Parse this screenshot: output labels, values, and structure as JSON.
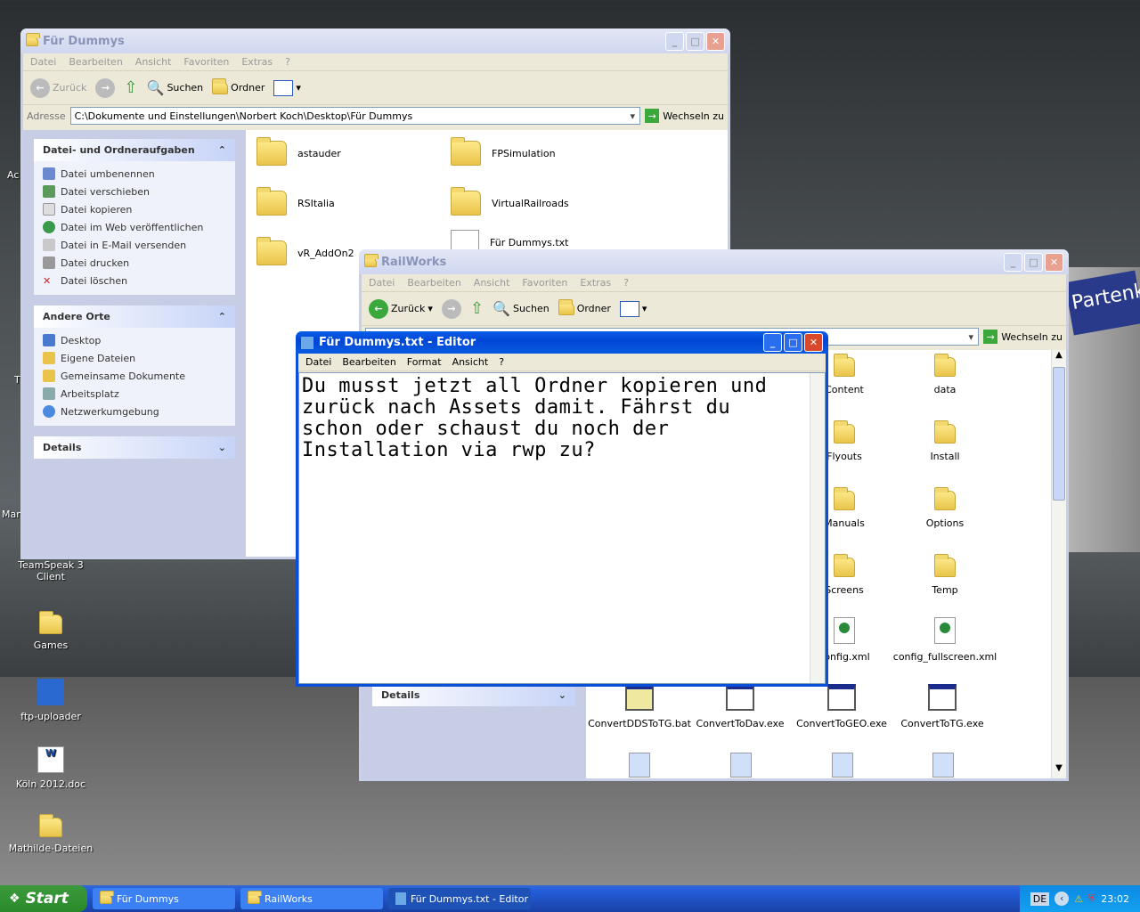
{
  "desktop": {
    "icons": [
      "TeamSpeak 3 Client",
      "Games",
      "ftp-uploader",
      "Köln 2012.doc",
      "Mathilde-Dateien"
    ],
    "partial_labels": [
      "Ac",
      "T",
      "Man"
    ],
    "bg_sign": "Partenkir"
  },
  "win1": {
    "title": "Für Dummys",
    "menu": [
      "Datei",
      "Bearbeiten",
      "Ansicht",
      "Favoriten",
      "Extras",
      "?"
    ],
    "toolbar": {
      "back": "Zurück",
      "search": "Suchen",
      "folders": "Ordner"
    },
    "address_label": "Adresse",
    "address": "C:\\Dokumente und Einstellungen\\Norbert Koch\\Desktop\\Für Dummys",
    "go": "Wechseln zu",
    "tasks_title": "Datei- und Ordneraufgaben",
    "tasks": [
      "Datei umbenennen",
      "Datei verschieben",
      "Datei kopieren",
      "Datei im Web veröffentlichen",
      "Datei in E-Mail versenden",
      "Datei drucken",
      "Datei löschen"
    ],
    "places_title": "Andere Orte",
    "places": [
      "Desktop",
      "Eigene Dateien",
      "Gemeinsame Dokumente",
      "Arbeitsplatz",
      "Netzwerkumgebung"
    ],
    "details_title": "Details",
    "files": [
      "astauder",
      "FPSimulation",
      "RSItalia",
      "VirtualRailroads",
      "vR_AddOn2",
      "Für Dummys.txt"
    ]
  },
  "win2": {
    "title": "RailWorks",
    "menu": [
      "Datei",
      "Bearbeiten",
      "Ansicht",
      "Favoriten",
      "Extras",
      "?"
    ],
    "toolbar": {
      "back": "Zurück",
      "search": "Suchen",
      "folders": "Ordner"
    },
    "go": "Wechseln zu",
    "details_title": "Details",
    "files": [
      "Content",
      "data",
      "Flyouts",
      "Install",
      "Manuals",
      "Options",
      "Screens",
      "Temp",
      "config.xml",
      "config_fullscreen.xml",
      "ConvertDDSToTG.bat",
      "ConvertToDav.exe",
      "ConvertToGEO.exe",
      "ConvertToTG.exe"
    ]
  },
  "editor": {
    "title": "Für Dummys.txt - Editor",
    "menu": [
      "Datei",
      "Bearbeiten",
      "Format",
      "Ansicht",
      "?"
    ],
    "text": "Du musst jetzt all Ordner kopieren und\nzurück nach Assets damit. Fährst du\nschon oder schaust du noch der\nInstallation via rwp zu?"
  },
  "taskbar": {
    "start": "Start",
    "tasks": [
      "Für Dummys",
      "RailWorks",
      "Für Dummys.txt - Editor"
    ],
    "lang": "DE",
    "clock": "23:02"
  }
}
